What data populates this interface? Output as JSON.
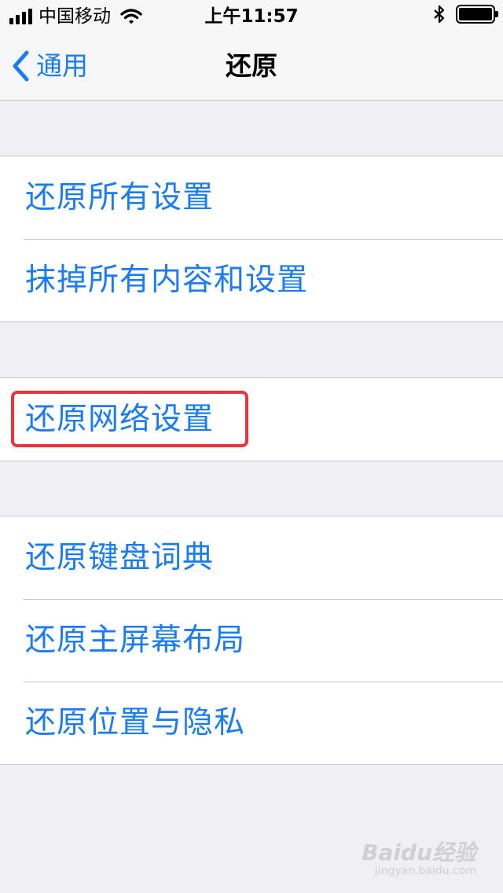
{
  "status_bar": {
    "carrier": "中国移动",
    "time": "上午11:57",
    "battery_level": 1.0,
    "icons": [
      "signal-bars-icon",
      "wifi-icon",
      "bluetooth-icon",
      "battery-icon"
    ]
  },
  "nav": {
    "back_label": "通用",
    "title": "还原"
  },
  "groups": [
    {
      "items": [
        {
          "label": "还原所有设置"
        },
        {
          "label": "抹掉所有内容和设置"
        }
      ]
    },
    {
      "items": [
        {
          "label": "还原网络设置",
          "highlighted": true
        }
      ]
    },
    {
      "items": [
        {
          "label": "还原键盘词典"
        },
        {
          "label": "还原主屏幕布局"
        },
        {
          "label": "还原位置与隐私"
        }
      ]
    }
  ],
  "colors": {
    "accent": "#1a7cf5",
    "background": "#efeff4",
    "highlight": "#e8333a"
  },
  "watermark": {
    "main": "Baidu经验",
    "sub": "jingyan.baidu.com"
  }
}
